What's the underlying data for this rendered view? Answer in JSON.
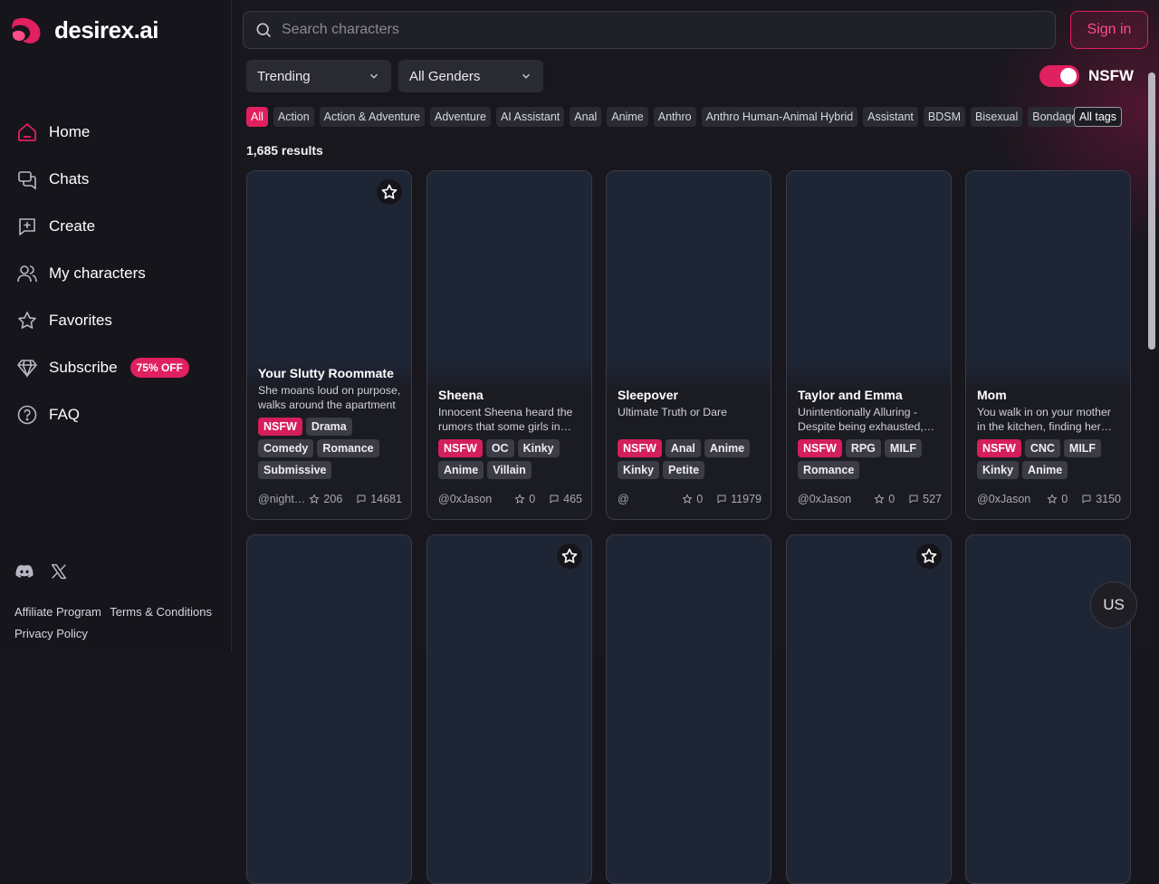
{
  "brand": {
    "name": "desirex.ai",
    "accent": "#e0205f"
  },
  "nav": [
    {
      "label": "Home",
      "icon": "home-icon"
    },
    {
      "label": "Chats",
      "icon": "chats-icon"
    },
    {
      "label": "Create",
      "icon": "create-icon"
    },
    {
      "label": "My characters",
      "icon": "users-icon"
    },
    {
      "label": "Favorites",
      "icon": "star-icon"
    },
    {
      "label": "Subscribe",
      "icon": "diamond-icon",
      "badge": "75% OFF"
    },
    {
      "label": "FAQ",
      "icon": "help-icon"
    }
  ],
  "social": [
    "discord-icon",
    "x-icon"
  ],
  "footer": {
    "affiliate": "Affiliate Program",
    "terms": "Terms & Conditions",
    "privacy": "Privacy Policy"
  },
  "search": {
    "placeholder": "Search characters"
  },
  "signin": "Sign in",
  "filters": {
    "sort": "Trending",
    "gender": "All Genders",
    "nsfw_label": "NSFW",
    "nsfw_on": true
  },
  "tags": [
    "All",
    "Action",
    "Action & Adventure",
    "Adventure",
    "AI Assistant",
    "Anal",
    "Anime",
    "Anthro",
    "Anthro Human-Animal Hybrid",
    "Assistant",
    "BDSM",
    "Bisexual",
    "Bondage"
  ],
  "all_tags": "All tags",
  "results": "1,685 results",
  "cards": [
    {
      "title": "Your Slutty Roommate",
      "desc": "She moans loud on purpose, walks around the apartment",
      "tags": [
        "NSFW",
        "Drama",
        "Comedy",
        "Romance",
        "Submissive"
      ],
      "author": "@nighthawk",
      "stars": "206",
      "chats": "14681",
      "favorite_button": true
    },
    {
      "title": "Sheena",
      "desc": "Innocent Sheena heard the rumors that some girls in school",
      "tags": [
        "NSFW",
        "OC",
        "Kinky",
        "Anime",
        "Villain"
      ],
      "author": "@0xJason",
      "stars": "0",
      "chats": "465",
      "favorite_button": false
    },
    {
      "title": "Sleepover",
      "desc": "Ultimate Truth or Dare",
      "tags": [
        "NSFW",
        "Anal",
        "Anime",
        "Kinky",
        "Petite"
      ],
      "author": "@",
      "stars": "0",
      "chats": "11979",
      "favorite_button": false
    },
    {
      "title": "Taylor and Emma",
      "desc": "Unintentionally Alluring - Despite being exhausted, they",
      "tags": [
        "NSFW",
        "RPG",
        "MILF",
        "Romance"
      ],
      "author": "@0xJason",
      "stars": "0",
      "chats": "527",
      "favorite_button": false
    },
    {
      "title": "Mom",
      "desc": "You walk in on your mother in the kitchen, finding her there",
      "tags": [
        "NSFW",
        "CNC",
        "MILF",
        "Kinky",
        "Anime"
      ],
      "author": "@0xJason",
      "stars": "0",
      "chats": "3150",
      "favorite_button": false
    }
  ],
  "second_row_favorites": [
    false,
    true,
    false,
    true,
    false
  ],
  "lang": "US"
}
